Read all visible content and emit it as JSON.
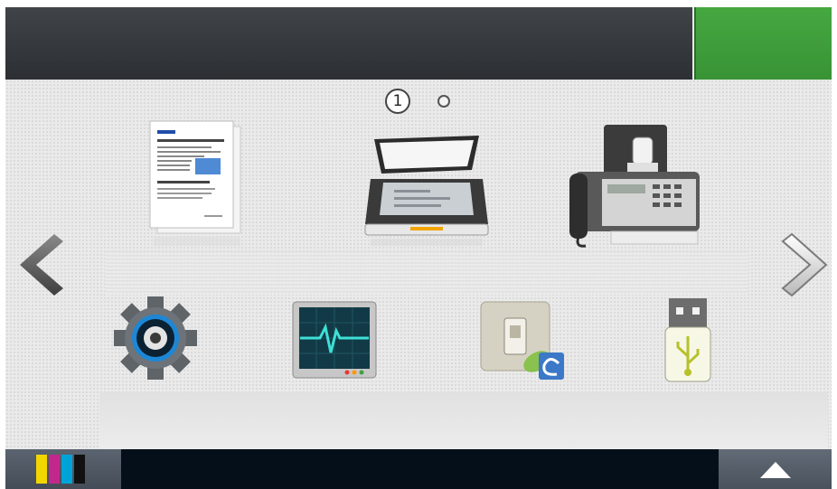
{
  "page_indicator": {
    "current": "1"
  },
  "colors": {
    "status_green": "#46a841",
    "topbar": "#34373b",
    "bottombar": "#050f19",
    "toner_cyan": "#00a3d9",
    "toner_magenta": "#c2288c",
    "toner_yellow": "#f2d600",
    "toner_black": "#111111"
  },
  "icons": {
    "row1": [
      "copy-icon",
      "scan-icon",
      "fax-icon"
    ],
    "row2": [
      "settings-icon",
      "job-status-icon",
      "eco-icon",
      "usb-icon"
    ]
  }
}
